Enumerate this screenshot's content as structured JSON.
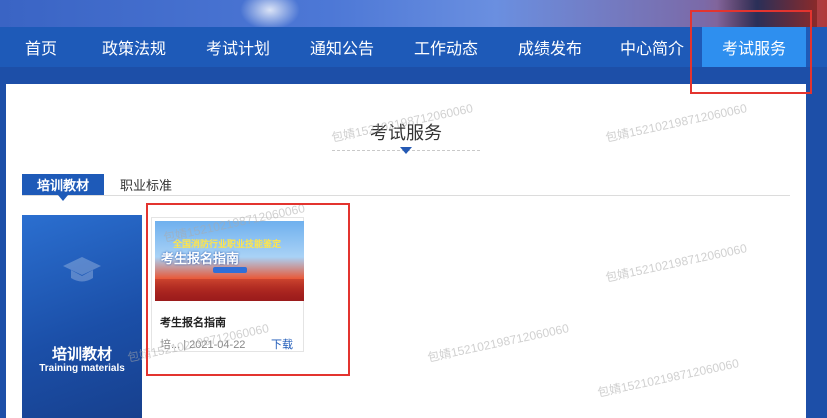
{
  "nav": {
    "items": [
      {
        "label": "首页",
        "active": false
      },
      {
        "label": "政策法规",
        "active": false
      },
      {
        "label": "考试计划",
        "active": false
      },
      {
        "label": "通知公告",
        "active": false
      },
      {
        "label": "工作动态",
        "active": false
      },
      {
        "label": "成绩发布",
        "active": false
      },
      {
        "label": "中心简介",
        "active": false
      },
      {
        "label": "考试服务",
        "active": true
      }
    ]
  },
  "section": {
    "title": "考试服务"
  },
  "tabs": [
    {
      "label": "培训教材",
      "active": true
    },
    {
      "label": "职业标准",
      "active": false
    }
  ],
  "side_block": {
    "title_cn": "培训教材",
    "title_en": "Training materials"
  },
  "card": {
    "thumb_line1": "全国消防行业职业技能鉴定",
    "thumb_line2": "考生报名指南",
    "name": "考生报名指南",
    "meta_prefix": "培...",
    "date": "2021-04-22",
    "download_label": "下载"
  },
  "watermark": {
    "text": "包婧152102198712060060"
  },
  "colors": {
    "nav_bg": "#1e5ab8",
    "nav_active": "#2e8fef",
    "highlight": "#e3342f"
  }
}
